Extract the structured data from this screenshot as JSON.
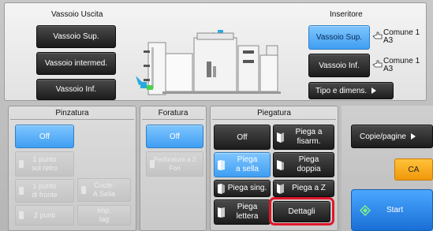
{
  "output_tray": {
    "title": "Vassoio Uscita",
    "buttons": [
      "Vassoio Sup.",
      "Vassoio intermed.",
      "Vassoio Inf."
    ]
  },
  "inserter": {
    "title": "Inseritore",
    "upper_tray_label": "Vassoio Sup.",
    "lower_tray_label": "Vassoio Inf.",
    "upper_paper": {
      "line1": "Comune 1",
      "line2": "A3"
    },
    "lower_paper": {
      "line1": "Comune 1",
      "line2": "A3"
    },
    "type_size_label": "Tipo e dimens."
  },
  "stapling": {
    "title": "Pinzatura",
    "off_label": "Off",
    "one_back": [
      "1 punto",
      "sul retro"
    ],
    "one_front": [
      "1 punto",
      "di fronte"
    ],
    "two_points": "2 punti",
    "saddle_stitch": [
      "Cucitr.",
      "A Sella"
    ],
    "binding": [
      "Imp.",
      "tag"
    ]
  },
  "punch": {
    "title": "Foratura",
    "off_label": "Off",
    "hole_option": [
      "Perforatura a 2",
      "Fori"
    ]
  },
  "folding": {
    "title": "Piegatura",
    "off_label": "Off",
    "accordion": [
      "Piega a",
      "fisarm."
    ],
    "saddle_fold": [
      "Piega",
      "a sella"
    ],
    "double_fold": [
      "Piega",
      "doppia"
    ],
    "single_fold": "Piega sing.",
    "z_fold": "Piega a Z",
    "letter_fold": [
      "Piega",
      "lettera"
    ],
    "details_label": "Dettagli"
  },
  "side": {
    "copies_pages_label": "Copie/pagine",
    "ca_label": "CA",
    "start_label": "Start"
  },
  "colors": {
    "selected_blue": "#4aa8f5",
    "ca_orange": "#f5a30c",
    "start_blue": "#1f7ae0",
    "highlight_red": "#e0162b"
  }
}
